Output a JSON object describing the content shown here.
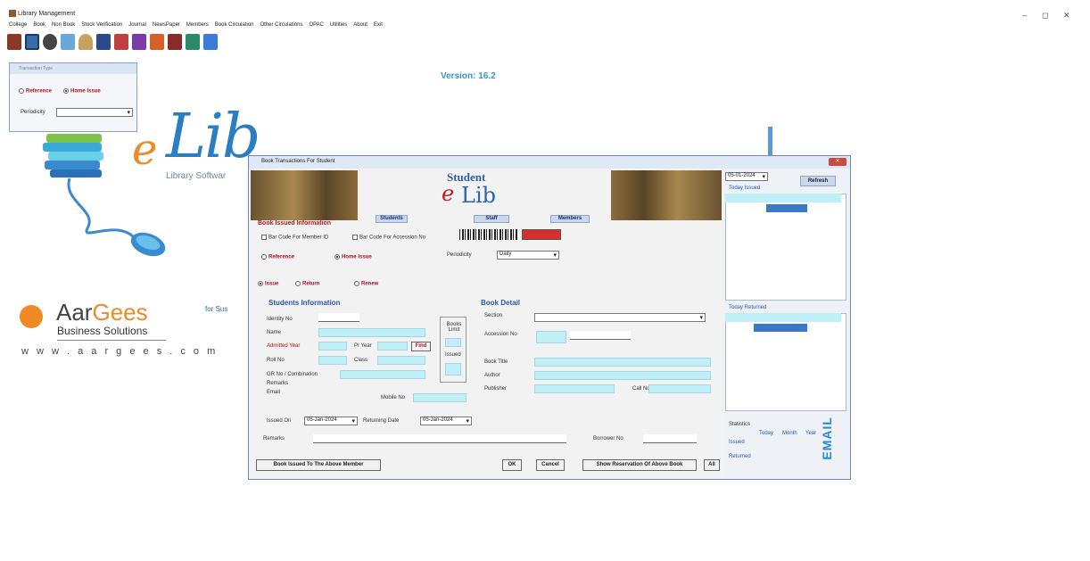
{
  "window": {
    "title": "Library Management",
    "minimize": "–",
    "maximize": "◻",
    "close": "✕"
  },
  "menu": [
    "College",
    "Book",
    "Non Book",
    "Stock Verification",
    "Journal",
    "NewsPaper",
    "Members",
    "Book Circulation",
    "Other Circulations",
    "OPAC",
    "Utilities",
    "About",
    "Exit"
  ],
  "version": "Version: 16.2",
  "small_window": {
    "title": "Transaction Type",
    "options": [
      "Reference",
      "Home Issue"
    ],
    "selected": "Home Issue",
    "periodicity_label": "Periodicity",
    "periodicity_value": ""
  },
  "logo": {
    "e": "e",
    "lib": "Lib",
    "tagline": "Library Softwar"
  },
  "company": {
    "name_part1": "Aar",
    "name_part2": "Gees",
    "subtitle": "Business Solutions",
    "website": "w w w . a a r g e e s . c o m",
    "side_text": "for Sus"
  },
  "dialog": {
    "title": "Book Transactions For Student",
    "close": "✕",
    "banner_title": "Student",
    "banner_e": "e",
    "banner_lib": "Lib",
    "section_title": "Book Issued Information",
    "tabs": [
      "Students",
      "Staff",
      "Members"
    ],
    "barcode_member": "Bar Code For Member ID",
    "barcode_accession": "Bar Code For Accession No",
    "types": [
      "Reference",
      "Home Issue"
    ],
    "type_selected": "Home Issue",
    "periodicity_label": "Periodicity",
    "periodicity_value": "Daily",
    "actions": [
      "Issue",
      "Return",
      "Renew"
    ],
    "action_selected": "Issue",
    "students_info": {
      "heading": "Students Information",
      "identity_label": "Identity No",
      "name_label": "Name",
      "admitted_year_label": "Admitted Year",
      "pr_year_label": "Pr Year",
      "find_label": "Find",
      "roll_label": "Roll No",
      "class_label": "Class",
      "gr_label": "GR No / Combination",
      "remarks_label": "Remarks",
      "email_label": "Email",
      "mobile_label": "Mobile No",
      "books_limit_label": "Books Limit",
      "issued_label": "Issued"
    },
    "book_detail": {
      "heading": "Book Detail",
      "section_label": "Section",
      "accession_label": "Accession No",
      "title_label": "Book Title",
      "author_label": "Author",
      "publisher_label": "Publisher",
      "callno_label": "Call No"
    },
    "issued_on_label": "Issued On",
    "issued_on_value": "05-Jan-2024",
    "returning_label": "Returning Date",
    "returning_value": "05-Jan-2024",
    "remarks_label": "Remarks",
    "borrower_label": "Borrower No",
    "buttons": {
      "issued_to_member": "Book Issued To The Above Member",
      "ok": "OK",
      "cancel": "Cancel",
      "show_reservation": "Show Reservation Of Above Book",
      "all": "All"
    },
    "right": {
      "date_value": "05-01-2024",
      "refresh": "Refresh",
      "today_issued": "Today Issued",
      "today_returned": "Today Returned",
      "statistics": "Statistics",
      "stat_cols": [
        "Today",
        "Month",
        "Year"
      ],
      "stat_rows": [
        "Issued",
        "Returned"
      ],
      "email": "EMAIL"
    }
  }
}
